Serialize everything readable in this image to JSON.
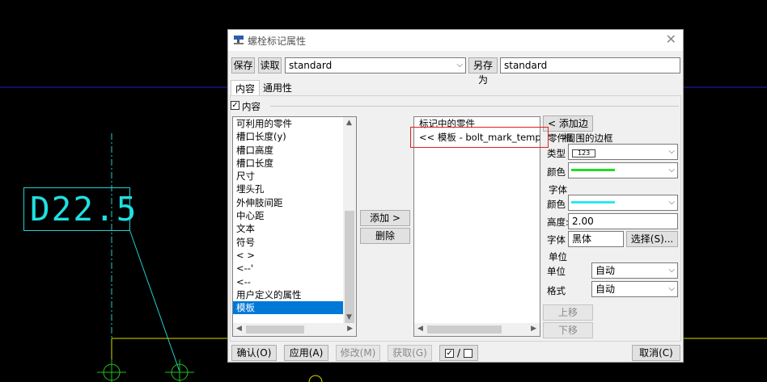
{
  "cad": {
    "dimension_label": "D22.5"
  },
  "dialog": {
    "title": "螺栓标记属性",
    "toolbar": {
      "save_label": "保存",
      "load_label": "读取",
      "preset_value": "standard",
      "save_as_label": "另存为",
      "save_as_value": "standard"
    },
    "tabs": [
      "内容",
      "通用性"
    ],
    "content_checkbox_label": "内容",
    "available_title": "可利用的零件",
    "available_items": [
      "槽口长度(y)",
      "槽口高度",
      "槽口长度",
      "尺寸",
      "埋头孔",
      "外伸肢间距",
      "中心距",
      "文本",
      "符号",
      "< >",
      "<--'",
      "<--",
      "用户定义的属性",
      "模板"
    ],
    "selected_available": "模板",
    "add_label": "添加 >",
    "delete_label": "删除",
    "marked_title": "标记中的零件",
    "marked_items": [
      "<< 模板 - bolt_mark_template"
    ],
    "add_frame_label": "< 添加边框",
    "part_frame_title": "零件周围的边框",
    "type_label": "类型",
    "type_value": "123",
    "color_label": "颜色",
    "frame_color": "#22dd22",
    "font_section": "字体",
    "font_color_label": "颜色",
    "font_color": "#33e5ee",
    "height_label": "高度:",
    "height_value": "2.00",
    "font_label": "字体",
    "font_value": "黑体",
    "select_font_label": "选择(S)...",
    "unit_section": "单位",
    "unit_label": "单位",
    "unit_value": "自动",
    "format_label": "格式",
    "format_value": "自动",
    "move_up_label": "上移",
    "move_down_label": "下移",
    "footer": {
      "ok_label": "确认(O)",
      "apply_label": "应用(A)",
      "modify_label": "修改(M)",
      "get_label": "获取(G)",
      "toggle_symbol": "/",
      "cancel_label": "取消(C)"
    }
  },
  "colors": {
    "cad_cyan": "#1fe0e0",
    "cad_blue": "#2020c8",
    "cad_yellow": "#d8d800",
    "cad_green": "#20c020",
    "highlight_red": "#e02020",
    "selection_blue": "#0078d7"
  }
}
